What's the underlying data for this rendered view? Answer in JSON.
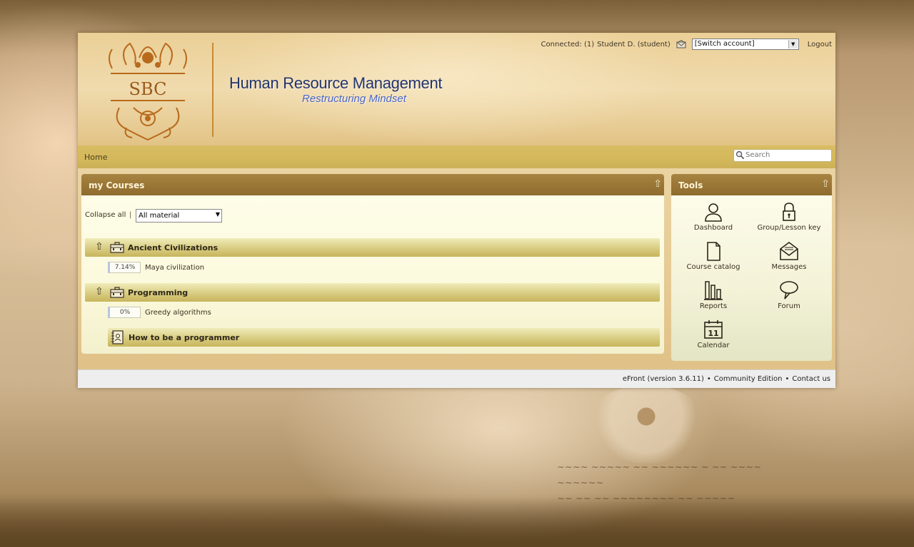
{
  "header": {
    "logo_text": "SBC",
    "title": "Human Resource Management",
    "subtitle": "Restructuring Mindset",
    "connected": "Connected: (1)",
    "user": "Student D. (student)",
    "switch_account": "[Switch account]",
    "logout": "Logout"
  },
  "nav": {
    "home": "Home",
    "search_placeholder": "Search"
  },
  "courses": {
    "title": "my Courses",
    "collapse_all": "Collapse all",
    "separator": "|",
    "filter_value": "All material",
    "groups": [
      {
        "title": "Ancient Civilizations",
        "lessons": [
          {
            "progress": "7.14%",
            "name": "Maya civilization"
          }
        ]
      },
      {
        "title": "Programming",
        "lessons": [
          {
            "progress": "0%",
            "name": "Greedy algorithms"
          }
        ]
      }
    ],
    "course": {
      "title": "How to be a programmer"
    }
  },
  "tools": {
    "title": "Tools",
    "items": [
      {
        "label": "Dashboard",
        "icon": "user-icon"
      },
      {
        "label": "Group/Lesson key",
        "icon": "lock-icon"
      },
      {
        "label": "Course catalog",
        "icon": "document-icon"
      },
      {
        "label": "Messages",
        "icon": "envelope-icon"
      },
      {
        "label": "Reports",
        "icon": "reports-icon"
      },
      {
        "label": "Forum",
        "icon": "speech-bubble-icon"
      },
      {
        "label": "Calendar",
        "icon": "calendar-icon"
      }
    ],
    "calendar_day": "11"
  },
  "footer": {
    "version": "eFront (version 3.6.11)",
    "edition": "Community Edition",
    "contact": "Contact us"
  },
  "colors": {
    "title": "#23336b",
    "subtitle": "#4a66c8",
    "panel_header": "#9a7636",
    "nav_bar": "#d4b85a"
  }
}
